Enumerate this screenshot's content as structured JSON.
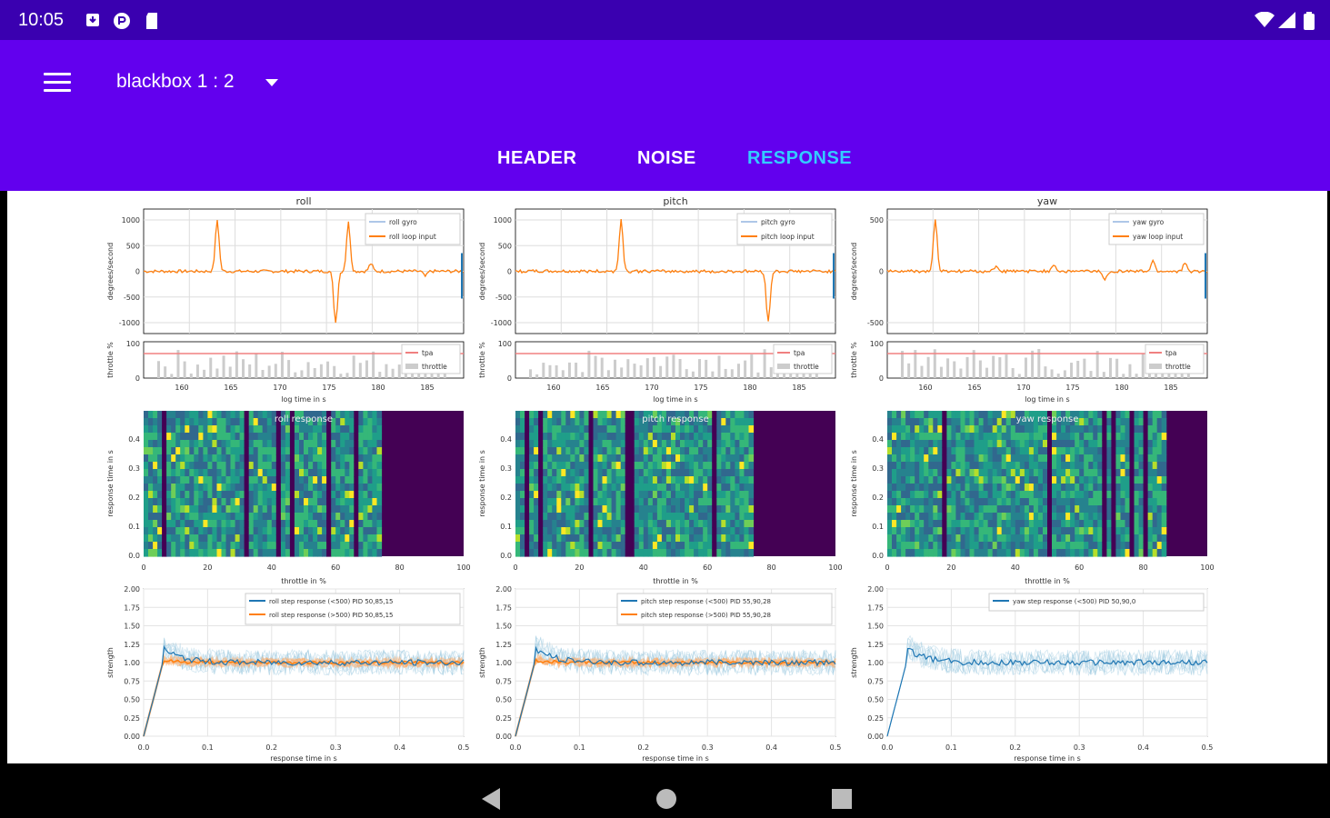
{
  "status": {
    "time": "10:05"
  },
  "appbar": {
    "title": "blackbox 1 : 2"
  },
  "tabs": [
    {
      "label": "HEADER",
      "active": false
    },
    {
      "label": "NOISE",
      "active": false
    },
    {
      "label": "RESPONSE",
      "active": true
    }
  ],
  "colors": {
    "status_bar": "#3a00b0",
    "app_bar": "#6200ee",
    "tab_active": "#33ccff",
    "gyro": "#1f77b4",
    "loop_input": "#ff7f0e"
  },
  "chart_data": [
    {
      "type": "line",
      "title": "roll",
      "ylabel": "degrees/second",
      "ylim": [
        -1200,
        1200
      ],
      "xlim": [
        155,
        188
      ],
      "series": [
        {
          "name": "roll gyro"
        },
        {
          "name": "roll loop input"
        }
      ],
      "yticks": [
        "1000",
        "500",
        "0",
        "-500",
        "-1000"
      ]
    },
    {
      "type": "line",
      "title": "pitch",
      "ylabel": "degrees/second",
      "ylim": [
        -1200,
        1200
      ],
      "xlim": [
        155,
        188
      ],
      "series": [
        {
          "name": "pitch gyro"
        },
        {
          "name": "pitch loop input"
        }
      ],
      "yticks": [
        "1000",
        "500",
        "0",
        "-500",
        "-1000"
      ]
    },
    {
      "type": "line",
      "title": "yaw",
      "ylabel": "degrees/second",
      "ylim": [
        -700,
        700
      ],
      "xlim": [
        155,
        188
      ],
      "series": [
        {
          "name": "yaw gyro"
        },
        {
          "name": "yaw loop input"
        }
      ],
      "yticks": [
        "500",
        "0",
        "-500"
      ]
    },
    {
      "type": "area",
      "ylabel": "throttle %",
      "xlabel": "log time in s",
      "ylim": [
        0,
        100
      ],
      "xticks": [
        "160",
        "165",
        "170",
        "175",
        "180",
        "185"
      ],
      "yticks": [
        "100",
        "0"
      ],
      "series": [
        {
          "name": "tpa"
        },
        {
          "name": "throttle"
        }
      ]
    },
    {
      "type": "heatmap",
      "titles": [
        "roll response",
        "pitch response",
        "yaw response"
      ],
      "xlabel": "throttle in %",
      "ylabel": "response time in s",
      "xticks": [
        "0",
        "20",
        "40",
        "60",
        "80",
        "100"
      ],
      "yticks": [
        "0.4",
        "0.3",
        "0.2",
        "0.1",
        "0.0"
      ]
    },
    {
      "type": "line",
      "xlabel": "response time in s",
      "ylabel": "strength",
      "ylim": [
        0,
        2
      ],
      "xlim": [
        0,
        0.5
      ],
      "xticks": [
        "0.0",
        "0.1",
        "0.2",
        "0.3",
        "0.4",
        "0.5"
      ],
      "yticks": [
        "2.00",
        "1.75",
        "1.50",
        "1.25",
        "1.00",
        "0.75",
        "0.50",
        "0.25",
        "0.00"
      ],
      "legends": [
        [
          "roll step response (<500)  PID 50,85,15",
          "roll step response (>500)  PID 50,85,15"
        ],
        [
          "pitch step response (<500)  PID 55,90,28",
          "pitch step response (>500)  PID 55,90,28"
        ],
        [
          "yaw step response (<500)  PID 50,90,0"
        ]
      ]
    }
  ]
}
